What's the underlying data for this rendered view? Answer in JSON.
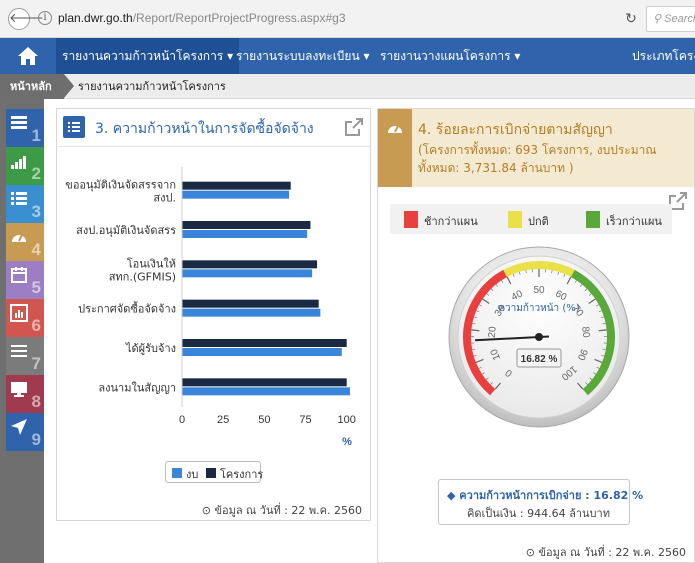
{
  "browser": {
    "url_host": "plan.dwr.go.th",
    "url_path": "/Report/ReportProjectProgress.aspx#g3",
    "search_placeholder": "Search"
  },
  "nav": {
    "items": [
      {
        "label": "รายงานความก้าวหน้าโครงการ ▾"
      },
      {
        "label": "รายงานระบบลงทะเบียน ▾"
      },
      {
        "label": "รายงานวางแผนโครงการ ▾"
      },
      {
        "label": "ประเภทโครงก"
      }
    ]
  },
  "breadcrumb": {
    "home": "หน้าหลัก",
    "current": "รายงานความก้าวหน้าโครงการ"
  },
  "sidebar": {
    "items": [
      {
        "num": "1",
        "color": "#2f63ab",
        "icon": "report-icon"
      },
      {
        "num": "2",
        "color": "#3d9a46",
        "icon": "signal-bars-icon"
      },
      {
        "num": "3",
        "color": "#3a8fd1",
        "icon": "list-icon"
      },
      {
        "num": "4",
        "color": "#c79b52",
        "icon": "dashboard-icon"
      },
      {
        "num": "5",
        "color": "#9c7ec4",
        "icon": "calendar-icon"
      },
      {
        "num": "6",
        "color": "#d0564f",
        "icon": "bar-chart-icon"
      },
      {
        "num": "7",
        "color": "#7b7b7b",
        "icon": "menu-icon"
      },
      {
        "num": "8",
        "color": "#a03b4f",
        "icon": "monitor-icon"
      },
      {
        "num": "9",
        "color": "#2f63ab",
        "icon": "location-arrow-icon"
      }
    ]
  },
  "panel3": {
    "title": "3. ความก้าวหน้าในการจัดซื้อจัดจ้าง",
    "footer": "⊙ ข้อมูล ณ วันที่ : 22 พ.ค. 2560"
  },
  "panel4": {
    "title": "4. ร้อยละการเบิกจ่ายตามสัญญา",
    "subtitle": "(โครงการทั้งหมด: 693 โครงการ, งบประมาณทั้งหมด: 3,731.84 ล้านบาท )",
    "legend": [
      {
        "label": "ช้ากว่าแผน",
        "color": "#e8403f"
      },
      {
        "label": "ปกติ",
        "color": "#e9e04a"
      },
      {
        "label": "เร็วกว่าแผน",
        "color": "#58a83a"
      }
    ],
    "caption_line1": "◆ ความก้าวหน้าการเบิกจ่าย : 16.82 %",
    "caption_line2": "คิดเป็นเงิน : 944.64 ล้านบาท",
    "footer": "⊙ ข้อมูล ณ วันที่ : 22 พ.ค. 2560"
  },
  "chart_data": [
    {
      "type": "bar",
      "orientation": "horizontal",
      "categories": [
        "ขออนุมัติเงินจัดสรรจาก\nสงป.",
        "สงป.อนุมัติเงินจัดสรร",
        "โอนเงินให้\nสทก.(GFMIS)",
        "ประกาศจัดซื้อจัดจ้าง",
        "ได้ผู้รับจ้าง",
        "ลงนามในสัญญา"
      ],
      "series": [
        {
          "name": "โครงการ",
          "color": "#1b2a44",
          "values": [
            66,
            78,
            82,
            83,
            100,
            100
          ]
        },
        {
          "name": "งบ",
          "color": "#3a85da",
          "values": [
            65,
            76,
            79,
            84,
            97,
            102
          ]
        }
      ],
      "xlabel": "%",
      "xlim": [
        0,
        102
      ],
      "xticks": [
        0,
        25,
        50,
        75,
        100
      ]
    },
    {
      "type": "gauge",
      "value": 16.82,
      "value_label": "16.82 %",
      "title": "ความก้าวหน้า (%)",
      "range": [
        0,
        100
      ],
      "ticks": [
        0,
        10,
        20,
        30,
        40,
        50,
        60,
        70,
        80,
        90,
        100
      ],
      "bands": [
        {
          "from": 0,
          "to": 40,
          "color": "#e8403f"
        },
        {
          "from": 40,
          "to": 60,
          "color": "#e9e04a"
        },
        {
          "from": 60,
          "to": 100,
          "color": "#58a83a"
        }
      ]
    }
  ]
}
